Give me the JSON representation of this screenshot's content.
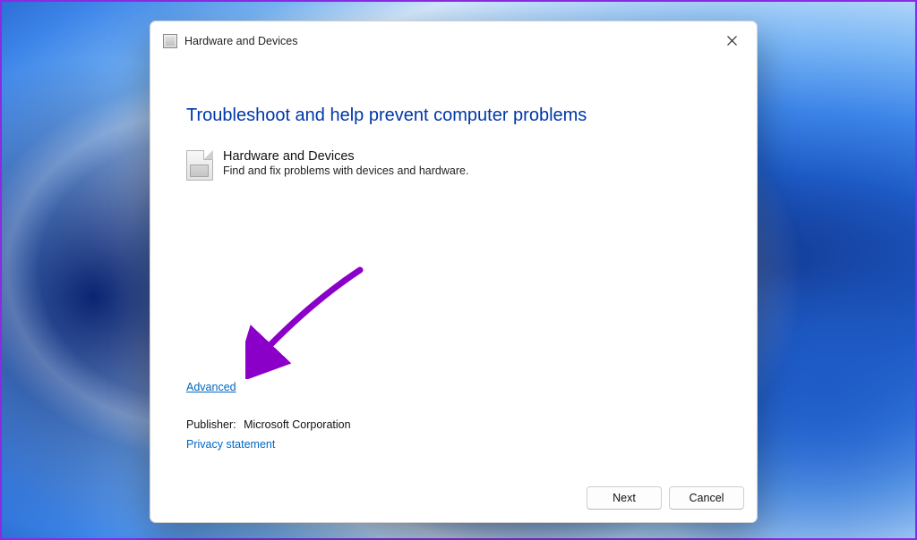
{
  "titlebar": {
    "title": "Hardware and Devices"
  },
  "dialog": {
    "heading": "Troubleshoot and help prevent computer problems",
    "troubleshooter": {
      "title": "Hardware and Devices",
      "description": "Find and fix problems with devices and hardware."
    },
    "advanced_label": "Advanced",
    "publisher_label": "Publisher:",
    "publisher_value": "Microsoft Corporation",
    "privacy_label": "Privacy statement"
  },
  "buttons": {
    "next": "Next",
    "cancel": "Cancel"
  }
}
